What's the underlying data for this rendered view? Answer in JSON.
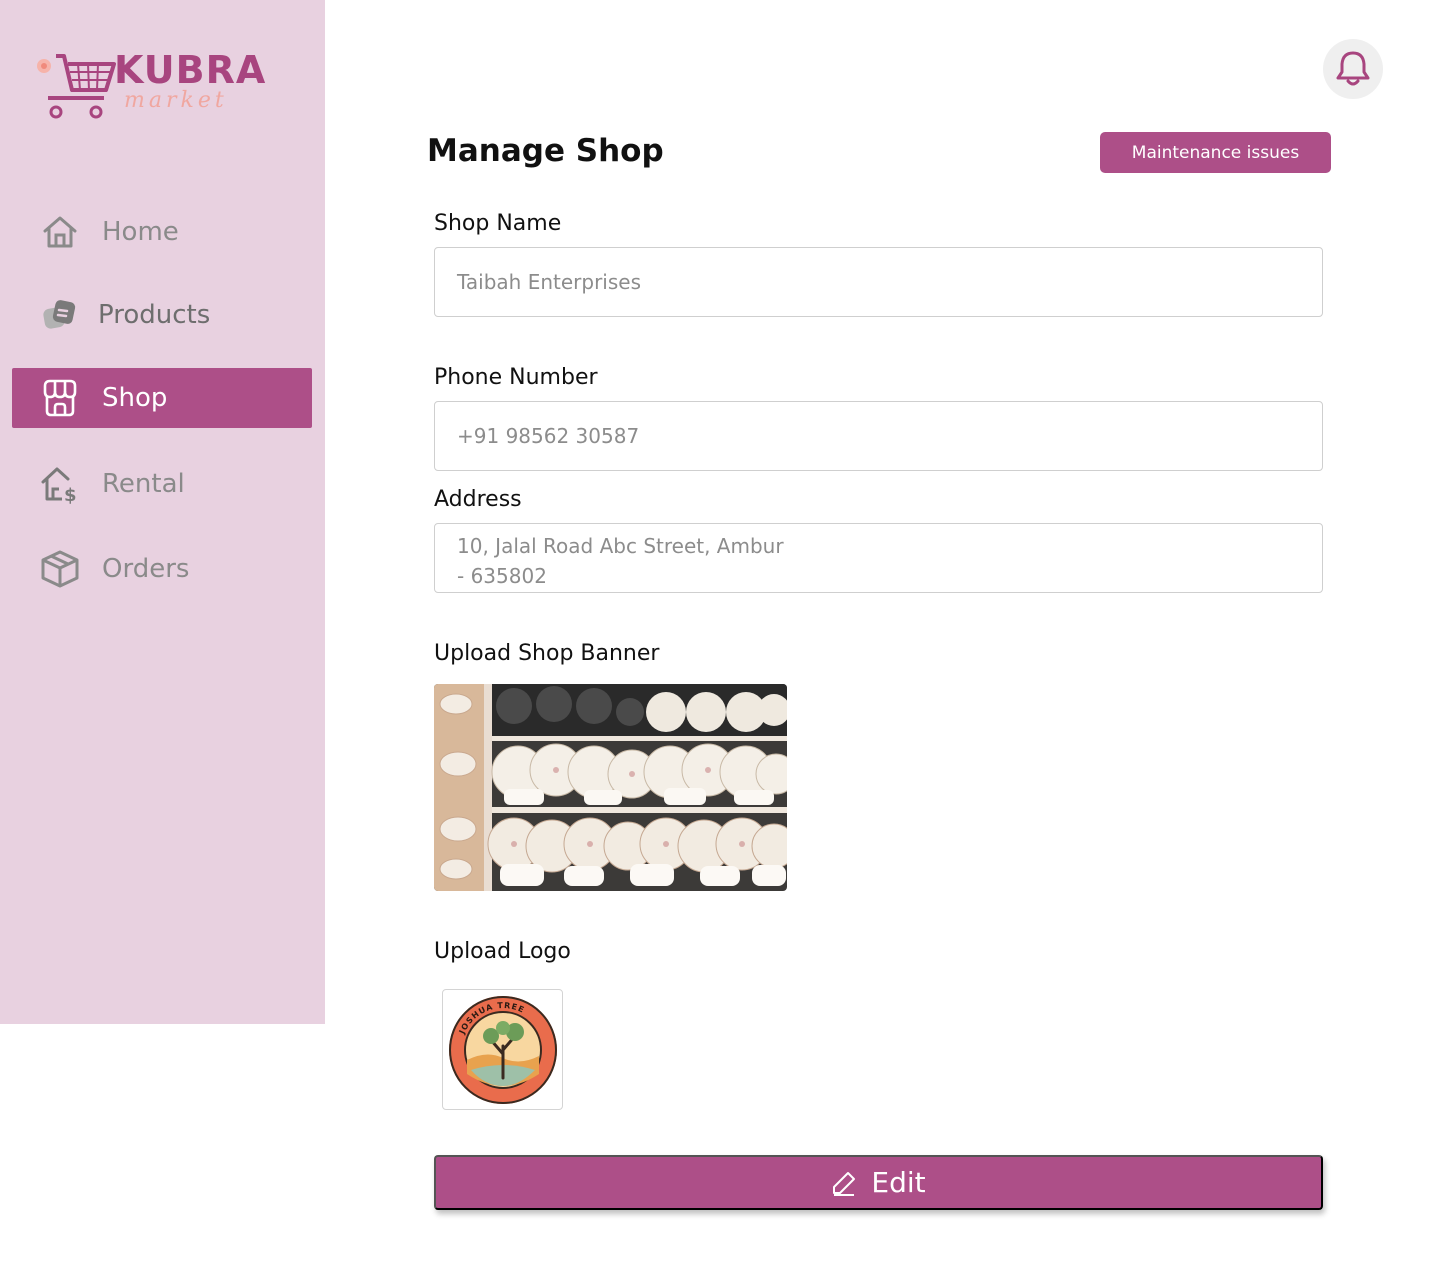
{
  "brand": {
    "name": "KUBRA",
    "sub": "market"
  },
  "sidebar": {
    "items": [
      {
        "label": "Home",
        "icon": "home-icon",
        "active": false
      },
      {
        "label": "Products",
        "icon": "products-icon",
        "active": false
      },
      {
        "label": "Shop",
        "icon": "shop-icon",
        "active": true
      },
      {
        "label": "Rental",
        "icon": "rental-icon",
        "active": false
      },
      {
        "label": "Orders",
        "icon": "orders-icon",
        "active": false
      }
    ]
  },
  "header": {
    "title": "Manage Shop",
    "maintenance_label": "Maintenance issues",
    "bell_icon": "bell-icon"
  },
  "form": {
    "shop_name": {
      "label": "Shop Name",
      "value": "Taibah Enterprises"
    },
    "phone": {
      "label": "Phone Number",
      "value": "+91 98562 30587"
    },
    "address": {
      "label": "Address",
      "line1": "10, Jalal Road Abc Street, Ambur",
      "line2": "- 635802"
    },
    "banner": {
      "label": "Upload Shop Banner"
    },
    "logo": {
      "label": "Upload Logo",
      "text": "JOSHUA TREE"
    },
    "edit_label": "Edit"
  },
  "colors": {
    "accent": "#ad4f88",
    "sidebar_bg": "#e8d1e0",
    "logo_pink": "#f0a7a0"
  }
}
